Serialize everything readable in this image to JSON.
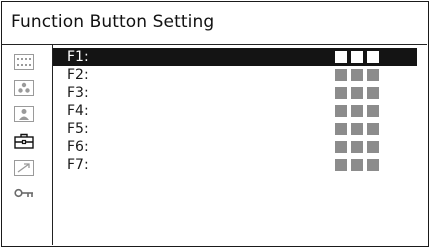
{
  "window": {
    "title": "Function Button Setting"
  },
  "sidebar": {
    "tabs": [
      {
        "icon": "dotted-grid-icon",
        "active": false
      },
      {
        "icon": "color-dots-icon",
        "active": false
      },
      {
        "icon": "person-icon",
        "active": false
      },
      {
        "icon": "toolbox-icon",
        "active": true
      },
      {
        "icon": "arrow-box-icon",
        "active": false
      },
      {
        "icon": "key-icon",
        "active": false
      }
    ]
  },
  "function_buttons": [
    {
      "label": "F1:",
      "selected": true
    },
    {
      "label": "F2:",
      "selected": false
    },
    {
      "label": "F3:",
      "selected": false
    },
    {
      "label": "F4:",
      "selected": false
    },
    {
      "label": "F5:",
      "selected": false
    },
    {
      "label": "F6:",
      "selected": false
    },
    {
      "label": "F7:",
      "selected": false
    }
  ],
  "colors": {
    "selected_bg": "#141414",
    "value_block": "#8c8c8c",
    "inactive_icon": "#9a9a9a"
  }
}
